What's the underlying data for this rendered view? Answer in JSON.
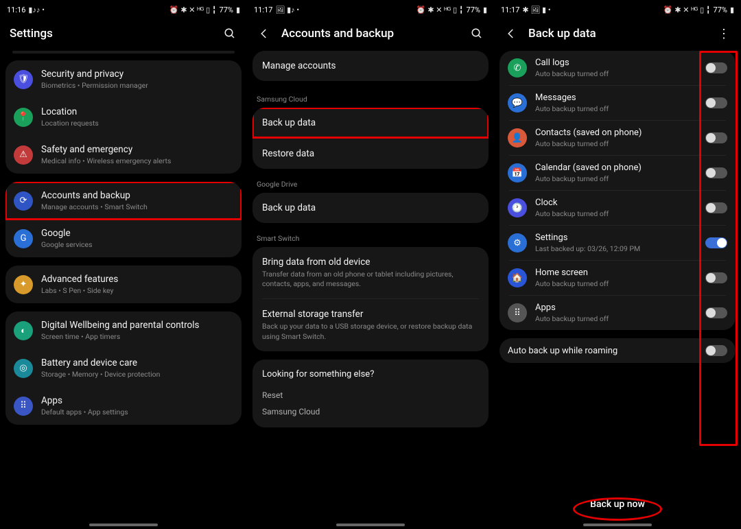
{
  "status": {
    "time1": "11:16",
    "time2": "11:17",
    "time3": "11:17",
    "battery": "77%"
  },
  "screen1": {
    "title": "Settings",
    "items": [
      {
        "title": "Security and privacy",
        "sub": "Biometrics  •  Permission manager"
      },
      {
        "title": "Location",
        "sub": "Location requests"
      },
      {
        "title": "Safety and emergency",
        "sub": "Medical info  •  Wireless emergency alerts"
      },
      {
        "title": "Accounts and backup",
        "sub": "Manage accounts  •  Smart Switch"
      },
      {
        "title": "Google",
        "sub": "Google services"
      },
      {
        "title": "Advanced features",
        "sub": "Labs  •  S Pen  •  Side key"
      },
      {
        "title": "Digital Wellbeing and parental controls",
        "sub": "Screen time  •  App timers"
      },
      {
        "title": "Battery and device care",
        "sub": "Storage  •  Memory  •  Device protection"
      },
      {
        "title": "Apps",
        "sub": "Default apps  •  App settings"
      }
    ]
  },
  "screen2": {
    "title": "Accounts and backup",
    "manage": "Manage accounts",
    "sec_samsung": "Samsung Cloud",
    "backup": "Back up data",
    "restore": "Restore data",
    "sec_drive": "Google Drive",
    "drive_backup": "Back up data",
    "sec_switch": "Smart Switch",
    "bring_title": "Bring data from old device",
    "bring_sub": "Transfer data from an old phone or tablet including pictures, contacts, apps, and messages.",
    "ext_title": "External storage transfer",
    "ext_sub": "Back up your data to a USB storage device, or restore backup data using Smart Switch.",
    "looking": "Looking for something else?",
    "reset": "Reset",
    "scloud": "Samsung Cloud"
  },
  "screen3": {
    "title": "Back up data",
    "items": [
      {
        "title": "Call logs",
        "sub": "Auto backup turned off",
        "on": false
      },
      {
        "title": "Messages",
        "sub": "Auto backup turned off",
        "on": false
      },
      {
        "title": "Contacts (saved on phone)",
        "sub": "Auto backup turned off",
        "on": false
      },
      {
        "title": "Calendar (saved on phone)",
        "sub": "Auto backup turned off",
        "on": false
      },
      {
        "title": "Clock",
        "sub": "Auto backup turned off",
        "on": false
      },
      {
        "title": "Settings",
        "sub": "Last backed up: 03/26, 12:09 PM",
        "on": true
      },
      {
        "title": "Home screen",
        "sub": "Auto backup turned off",
        "on": false
      },
      {
        "title": "Apps",
        "sub": "Auto backup turned off",
        "on": false
      }
    ],
    "roaming": "Auto back up while roaming",
    "button": "Back up now"
  }
}
